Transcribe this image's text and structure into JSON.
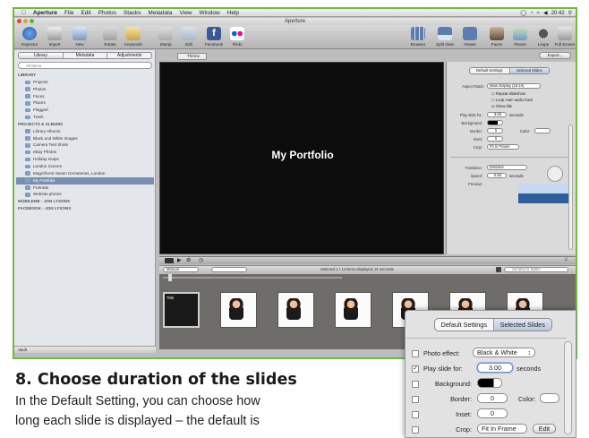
{
  "menubar": {
    "apple": "",
    "app": "Aperture",
    "items": [
      "File",
      "Edit",
      "Photos",
      "Stacks",
      "Metadata",
      "View",
      "Window",
      "Help"
    ],
    "time": "20:42"
  },
  "window": {
    "title": "Aperture"
  },
  "toolbar": {
    "left": [
      "Inspector",
      "Import",
      "New",
      "Rotate",
      "Keywords",
      "Stamp",
      "Edit",
      "Facebook",
      "Flickr"
    ],
    "right": [
      "Browser",
      "Split View",
      "Viewer",
      "Faces",
      "Places",
      "Loupe",
      "Full Screen"
    ]
  },
  "sidebar": {
    "tabs": [
      "Library",
      "Metadata",
      "Adjustments"
    ],
    "search_placeholder": "All Items",
    "tree": [
      {
        "label": "LIBRARY",
        "type": "head"
      },
      {
        "label": "Projects"
      },
      {
        "label": "Photos"
      },
      {
        "label": "Faces"
      },
      {
        "label": "Places"
      },
      {
        "label": "Flagged"
      },
      {
        "label": "Trash"
      },
      {
        "label": "PROJECTS & ALBUMS",
        "type": "head"
      },
      {
        "label": "Library Albums"
      },
      {
        "label": "Black and White Images"
      },
      {
        "label": "Camera Test Shots"
      },
      {
        "label": "eBay Photos"
      },
      {
        "label": "Holiday snaps"
      },
      {
        "label": "London Scenes"
      },
      {
        "label": "Magnificent Seven Cemeteries, London"
      },
      {
        "label": "My Portfolio",
        "type": "sel"
      },
      {
        "label": "Portraits"
      },
      {
        "label": "Website photos"
      },
      {
        "label": "MOBILEME - JON LYSONS",
        "type": "head"
      },
      {
        "label": "FACEBOOK - JON LYSONS",
        "type": "head"
      }
    ],
    "footer": "Vault"
  },
  "viewer": {
    "tab": "Theme",
    "title": "My Portfolio",
    "export_label": "Export..."
  },
  "panel": {
    "tabs": [
      "Default Settings",
      "Selected Slides"
    ],
    "aspect_ratio_label": "Aspect Ratio:",
    "aspect_ratio_value": "Main Display (16:10)",
    "repeat": "Repeat slideshow",
    "loop": "Loop main audio track",
    "show_title": "Show title",
    "play_label": "Play slide for:",
    "play_value": "3.00",
    "seconds": "seconds",
    "background": "Background:",
    "border": "Border:",
    "color": "Color:",
    "inset": "Inset:",
    "crop": "Crop:",
    "crop_value": "Fit In Frame",
    "transition": "Transition:",
    "transition_value": "Dissolve",
    "speed": "Speed:",
    "speed_value": "0.50",
    "preview": "Preview:",
    "zero": "0"
  },
  "controlbar": {
    "status": "Selected 1 / 14 items displayed, 31 seconds"
  },
  "browserbar": {
    "mode": "Manual",
    "search_placeholder": "Unrated or Better"
  },
  "filmstrip": {
    "thumbs": [
      {
        "badge": "Title",
        "stars": ""
      },
      {
        "badge": "",
        "stars": "★★★★★"
      },
      {
        "badge": "",
        "stars": "★★★★★"
      },
      {
        "badge": "",
        "stars": "★★★★★"
      },
      {
        "badge": "",
        "stars": ""
      },
      {
        "badge": "",
        "stars": "★★★★★"
      },
      {
        "badge": "",
        "stars": ""
      }
    ]
  },
  "zoom": {
    "tabs": [
      "Default Settings",
      "Selected Slides"
    ],
    "photo_effect": "Photo effect:",
    "photo_effect_value": "Black & White",
    "play_label": "Play slide for:",
    "play_value": "3.00",
    "seconds": "seconds",
    "background": "Background:",
    "border": "Border:",
    "border_value": "0",
    "color": "Color:",
    "inset": "Inset:",
    "inset_value": "0",
    "crop": "Crop:",
    "crop_value": "Fit In Frame",
    "edit": "Edit"
  },
  "article": {
    "headline": "8. Choose duration of the slides",
    "line1": "In the Default Setting, you can choose how",
    "line2": "long each slide is displayed – the default is"
  },
  "colors": {
    "frame_border": "#6dbb3f",
    "selection": "#7a8fb0",
    "viewer_bg": "#0c0c0c"
  }
}
